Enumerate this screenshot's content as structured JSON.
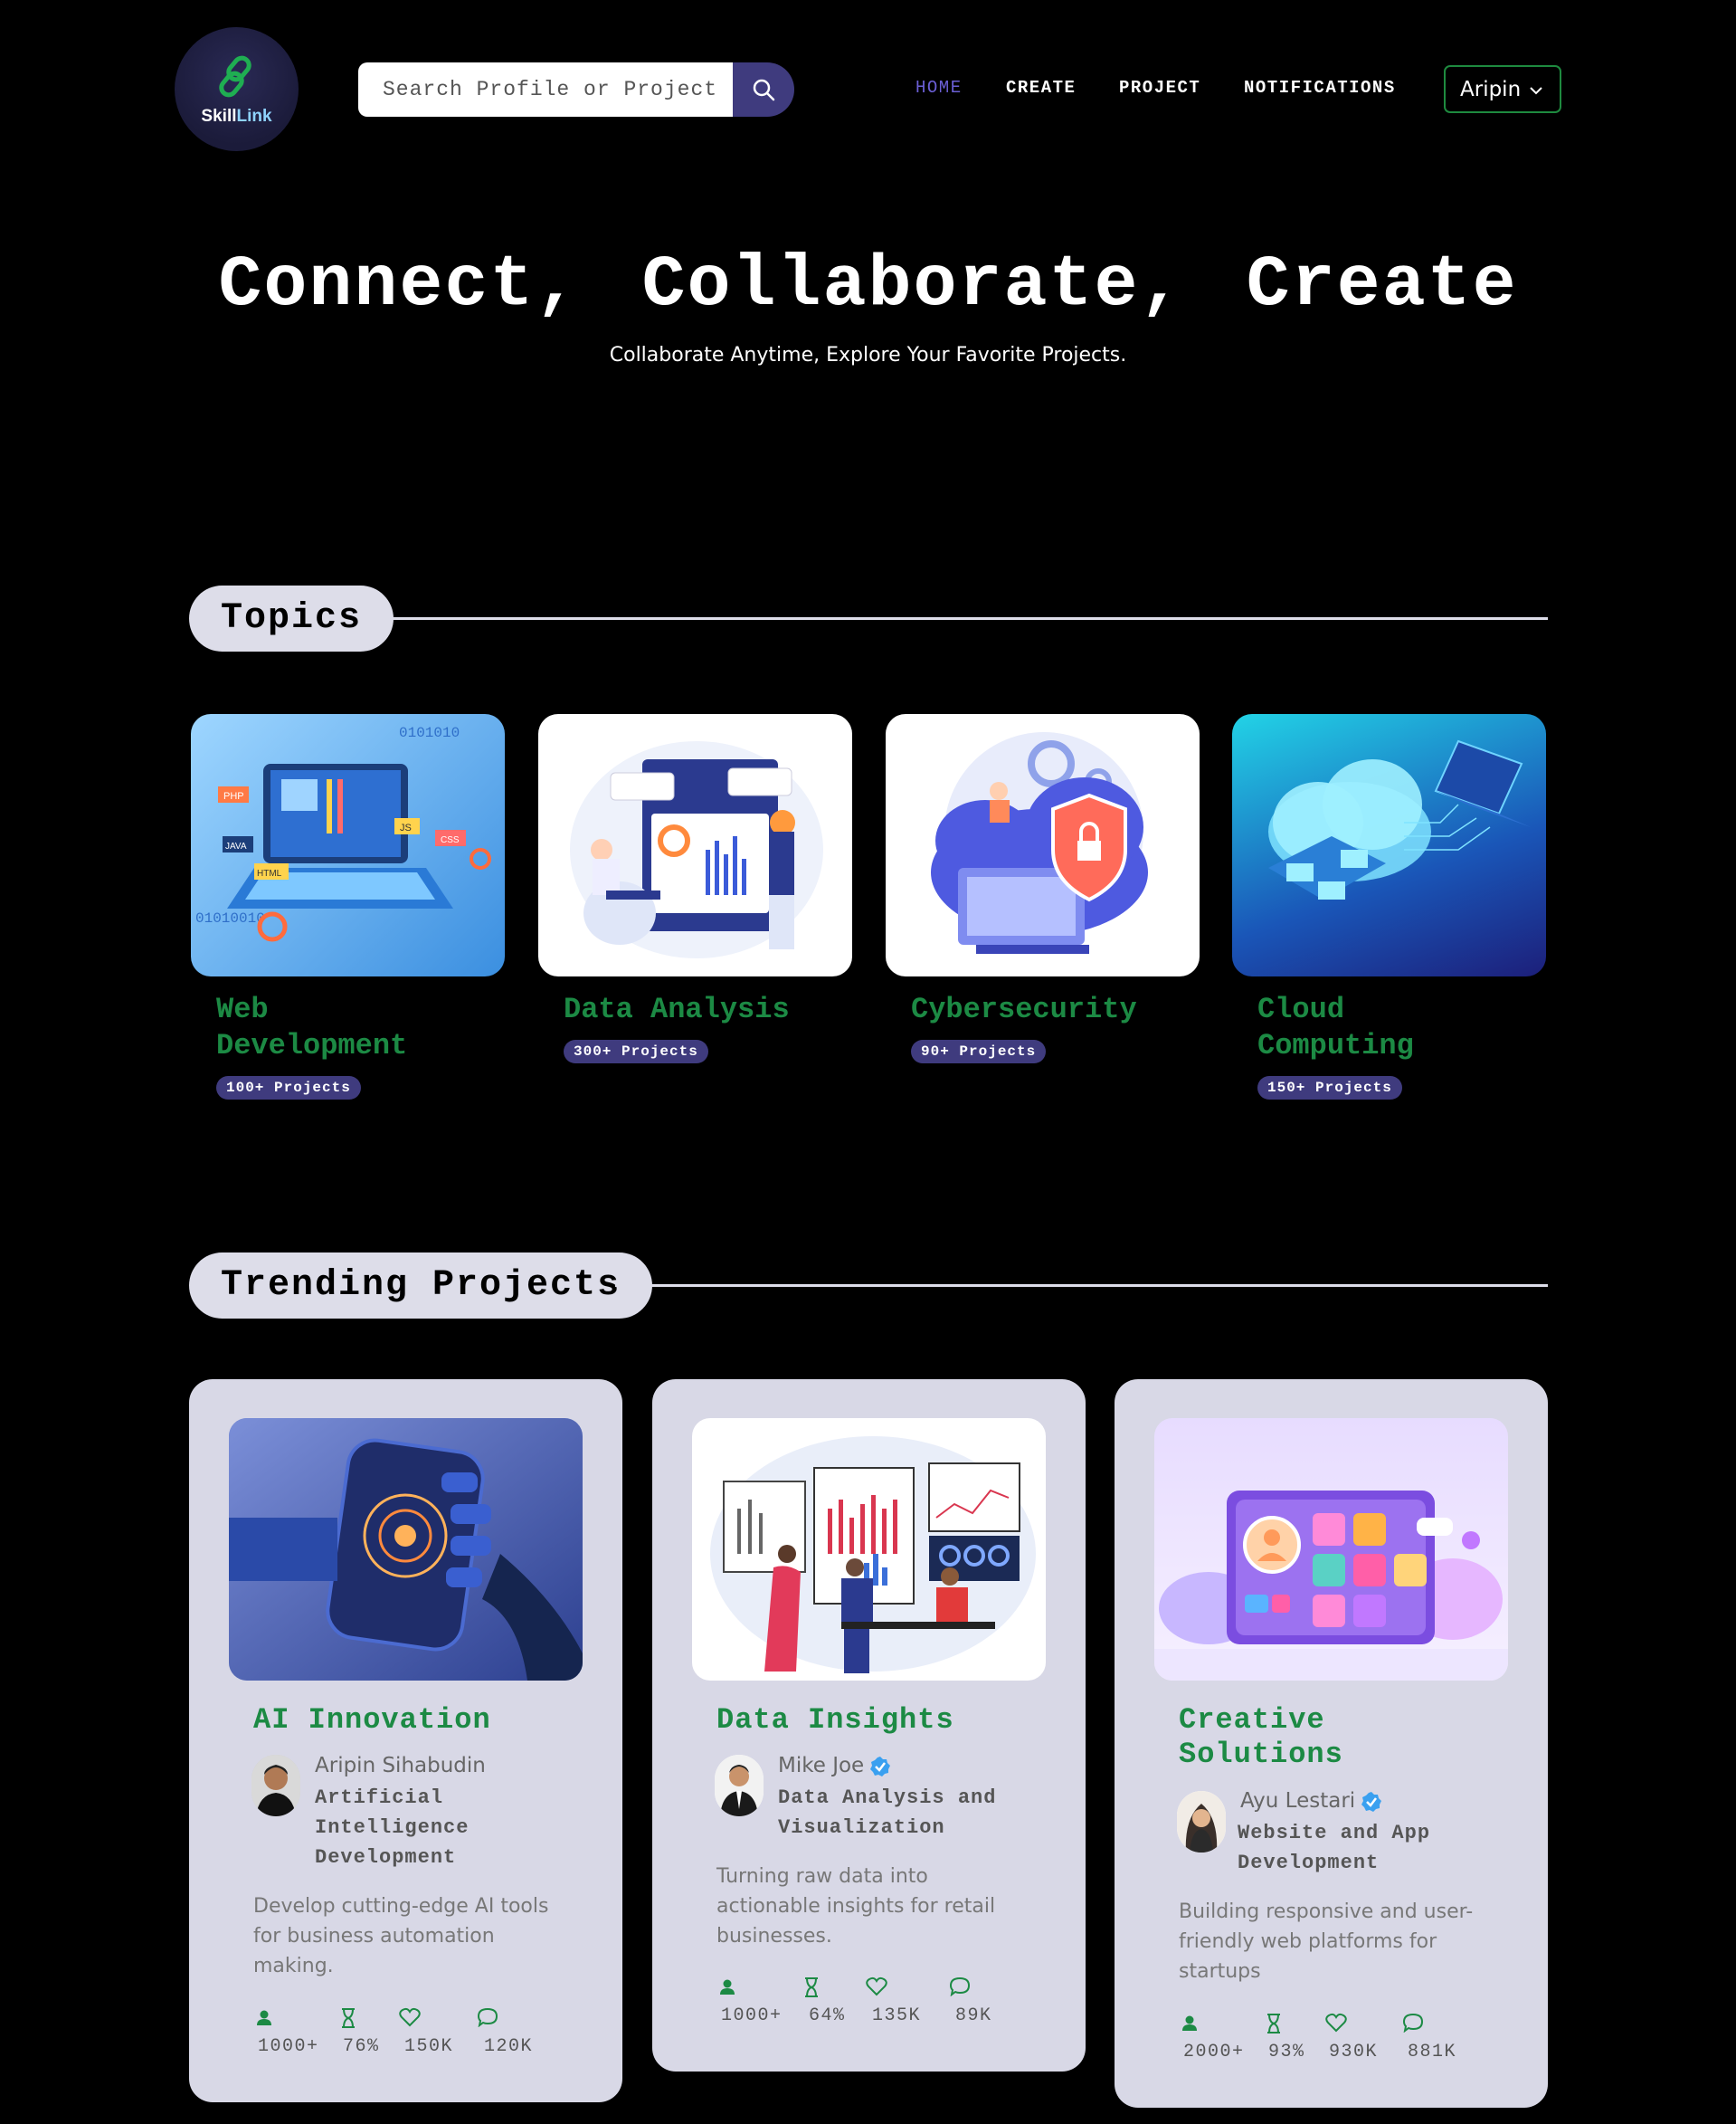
{
  "brand": {
    "name_a": "Skill",
    "name_b": "Link"
  },
  "search": {
    "placeholder": "Search Profile or Project"
  },
  "nav": {
    "home": "HOME",
    "create": "CREATE",
    "project": "PROJECT",
    "notifications": "NOTIFICATIONS"
  },
  "user": {
    "name": "Aripin"
  },
  "hero": {
    "title": "Connect, Collaborate, Create",
    "subtitle": "Collaborate Anytime, Explore Your Favorite Projects."
  },
  "topics": {
    "heading": "Topics",
    "items": [
      {
        "name": "Web Development",
        "count": "100+ Projects"
      },
      {
        "name": "Data Analysis",
        "count": "300+ Projects"
      },
      {
        "name": "Cybersecurity",
        "count": "90+ Projects"
      },
      {
        "name": "Cloud Computing",
        "count": "150+ Projects"
      }
    ]
  },
  "trending": {
    "heading": "Trending Projects",
    "cards": [
      {
        "title": "AI Innovation",
        "author": "Aripin Sihabudin",
        "verified": false,
        "role": "Artificial Intelligence Development",
        "description": "Develop cutting-edge AI tools for business automation making.",
        "stats": {
          "members": "1000+",
          "progress": "76%",
          "likes": "150K",
          "comments": "120K"
        }
      },
      {
        "title": "Data Insights",
        "author": "Mike Joe",
        "verified": true,
        "role": "Data Analysis and Visualization",
        "description": "Turning raw data into actionable insights for retail businesses.",
        "stats": {
          "members": "1000+",
          "progress": "64%",
          "likes": "135K",
          "comments": "89K"
        }
      },
      {
        "title": "Creative Solutions",
        "author": "Ayu Lestari",
        "verified": true,
        "role": "Website and App Development",
        "description": "Building responsive and user-friendly web platforms for startups",
        "stats": {
          "members": "2000+",
          "progress": "93%",
          "likes": "930K",
          "comments": "881K"
        }
      }
    ]
  },
  "icons": {
    "search": "search-icon",
    "chevron": "chevron-down-icon",
    "members": "user-icon",
    "progress": "hourglass-icon",
    "likes": "heart-icon",
    "comments": "comment-icon",
    "verified": "verified-badge-icon"
  },
  "colors": {
    "accent": "#3f3b7e",
    "green": "#1c8a44",
    "card_bg": "#d8d8e6",
    "pill_bg": "#dddde9",
    "nav_active": "#6b5fd6"
  }
}
